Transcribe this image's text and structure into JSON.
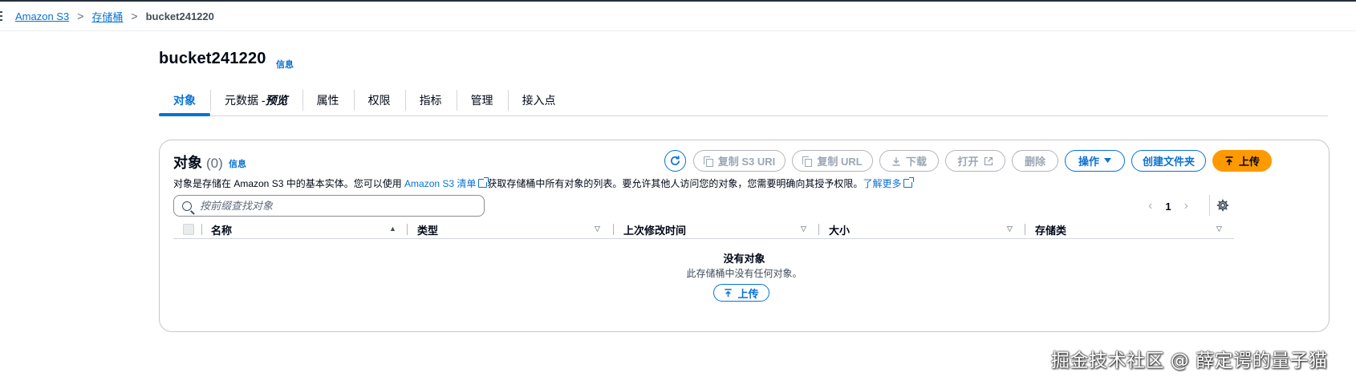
{
  "breadcrumb": {
    "items": [
      "Amazon S3",
      "存储桶"
    ],
    "current": "bucket241220",
    "separator": ">"
  },
  "page": {
    "title": "bucket241220",
    "info_label": "信息"
  },
  "tabs": [
    {
      "label": "对象",
      "active": true
    },
    {
      "label": "元数据 - ",
      "suffix": "预览"
    },
    {
      "label": "属性"
    },
    {
      "label": "权限"
    },
    {
      "label": "指标"
    },
    {
      "label": "管理"
    },
    {
      "label": "接入点"
    }
  ],
  "objects_panel": {
    "title": "对象",
    "count": "(0)",
    "info_label": "信息",
    "description_1": "对象是存储在 Amazon S3 中的基本实体。您可以使用 ",
    "description_link": "Amazon S3 清单",
    "description_2": "获取存储桶中所有对象的列表。要允许其他人访问您的对象，您需要明确向其授予权限。",
    "learn_more": "了解更多",
    "actions": {
      "copy_s3_uri": "复制 S3 URI",
      "copy_url": "复制 URL",
      "download": "下载",
      "open": "打开",
      "delete": "删除",
      "actions_menu": "操作",
      "create_folder": "创建文件夹",
      "upload": "上传"
    },
    "search_placeholder": "按前缀查找对象",
    "pagination": {
      "page": "1",
      "prev": "‹",
      "next": "›"
    },
    "columns": [
      "名称",
      "类型",
      "上次修改时间",
      "大小",
      "存储类"
    ],
    "empty_title": "没有对象",
    "empty_desc": "此存储桶中没有任何对象。",
    "empty_upload": "上传"
  },
  "colors": {
    "accent": "#0972d3",
    "primary_button": "#ff9900",
    "disabled": "#9ba7b6"
  },
  "watermark": "掘金技术社区 @ 薛定谔的量子猫"
}
